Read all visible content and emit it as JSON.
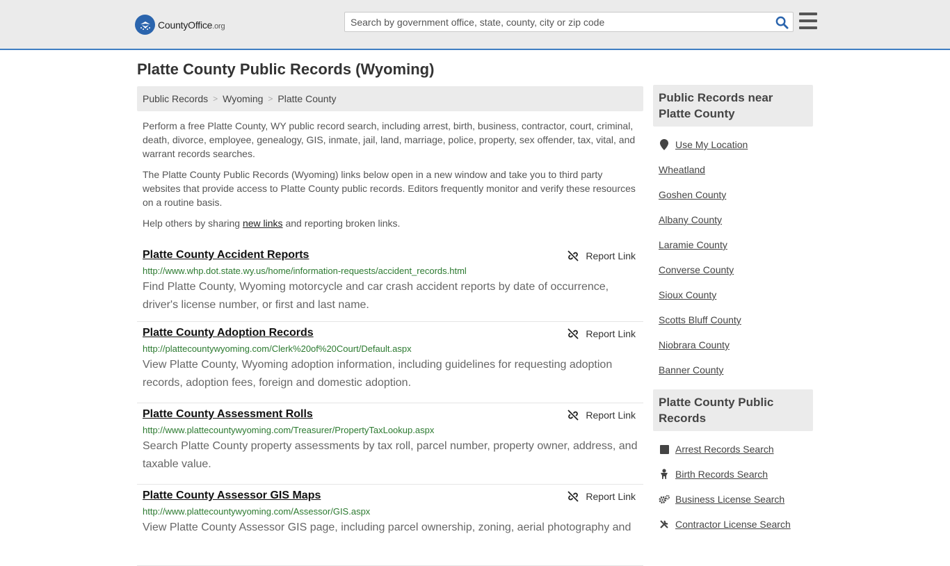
{
  "header": {
    "logo_main": "CountyOffice",
    "logo_org": ".org",
    "search_placeholder": "Search by government office, state, county, city or zip code"
  },
  "page_title": "Platte County Public Records (Wyoming)",
  "breadcrumb": [
    "Public Records",
    "Wyoming",
    "Platte County"
  ],
  "intro": {
    "p1": "Perform a free Platte County, WY public record search, including arrest, birth, business, contractor, court, criminal, death, divorce, employee, genealogy, GIS, inmate, jail, land, marriage, police, property, sex offender, tax, vital, and warrant records searches.",
    "p2": "The Platte County Public Records (Wyoming) links below open in a new window and take you to third party websites that provide access to Platte County public records. Editors frequently monitor and verify these resources on a routine basis.",
    "p3_before": "Help others by sharing ",
    "p3_link": "new links",
    "p3_after": " and reporting broken links."
  },
  "report_label": "Report Link",
  "records": [
    {
      "title": "Platte County Accident Reports",
      "url": "http://www.whp.dot.state.wy.us/home/information-requests/accident_records.html",
      "desc": "Find Platte County, Wyoming motorcycle and car crash accident reports by date of occurrence, driver's license number, or first and last name."
    },
    {
      "title": "Platte County Adoption Records",
      "url": "http://plattecountywyoming.com/Clerk%20of%20Court/Default.aspx",
      "desc": "View Platte County, Wyoming adoption information, including guidelines for requesting adoption records, adoption fees, foreign and domestic adoption."
    },
    {
      "title": "Platte County Assessment Rolls",
      "url": "http://www.plattecountywyoming.com/Treasurer/PropertyTaxLookup.aspx",
      "desc": "Search Platte County property assessments by tax roll, parcel number, property owner, address, and taxable value."
    },
    {
      "title": "Platte County Assessor GIS Maps",
      "url": "http://www.plattecountywyoming.com/Assessor/GIS.aspx",
      "desc": "View Platte County Assessor GIS page, including parcel ownership, zoning, aerial photography and"
    }
  ],
  "sidebar": {
    "nearby_title": "Public Records near Platte County",
    "use_location": "Use My Location",
    "nearby": [
      "Wheatland",
      "Goshen County",
      "Albany County",
      "Laramie County",
      "Converse County",
      "Sioux County",
      "Scotts Bluff County",
      "Niobrara County",
      "Banner County"
    ],
    "records_title": "Platte County Public Records",
    "record_links": [
      {
        "label": "Arrest Records Search",
        "icon": "square-icon"
      },
      {
        "label": "Birth Records Search",
        "icon": "baby-icon"
      },
      {
        "label": "Business License Search",
        "icon": "gears-icon"
      },
      {
        "label": "Contractor License Search",
        "icon": "tools-icon"
      }
    ]
  },
  "colors": {
    "header_bg": "#ebebeb",
    "accent_blue": "#3f7ec2",
    "url_green": "#2c7a30"
  }
}
